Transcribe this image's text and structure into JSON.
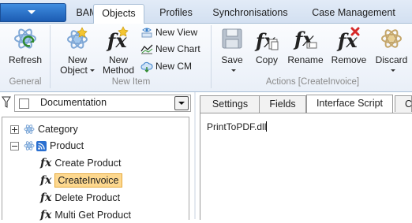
{
  "tabs": [
    {
      "label": "BAM",
      "active": false
    },
    {
      "label": "Objects",
      "active": true
    },
    {
      "label": "Profiles",
      "active": false
    },
    {
      "label": "Synchronisations",
      "active": false
    },
    {
      "label": "Case Management",
      "active": false
    }
  ],
  "ribbon": {
    "general": {
      "label": "General",
      "refresh": "Refresh"
    },
    "new_item": {
      "label": "New Item",
      "new_object": [
        "New",
        "Object"
      ],
      "new_method": [
        "New",
        "Method"
      ],
      "new_view": "New View",
      "new_chart": "New Chart",
      "new_cm": "New CM"
    },
    "actions": {
      "label": "Actions [CreateInvoice]",
      "save": "Save",
      "copy": "Copy",
      "rename": "Rename",
      "remove": "Remove",
      "discard": "Discard"
    }
  },
  "filter": {
    "value": "Documentation"
  },
  "tree": {
    "category": "Category",
    "product": "Product",
    "children": [
      {
        "label": "Create Product",
        "selected": false
      },
      {
        "label": "CreateInvoice",
        "selected": true
      },
      {
        "label": "Delete Product",
        "selected": false
      },
      {
        "label": "Multi Get Product",
        "selected": false
      }
    ]
  },
  "right_tabs": [
    {
      "label": "Settings",
      "active": false
    },
    {
      "label": "Fields",
      "active": false
    },
    {
      "label": "Interface Script",
      "active": true
    },
    {
      "label": "C",
      "active": false
    }
  ],
  "editor": {
    "content": "PrintToPDF.dll"
  },
  "colors": {
    "selection_fill": "#fdd88f",
    "app_button": "#2e74cc",
    "remove_accent": "#d62a2a"
  }
}
